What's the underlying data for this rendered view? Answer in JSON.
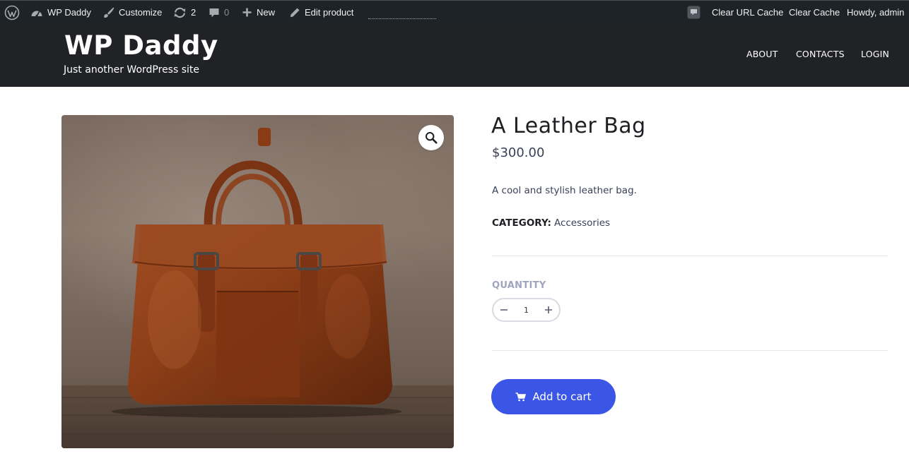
{
  "admin_bar": {
    "site_name": "WP Daddy",
    "customize": "Customize",
    "updates_count": "2",
    "comments_count": "0",
    "new": "New",
    "edit_product": "Edit product",
    "clear_url_cache": "Clear URL Cache",
    "clear_cache": "Clear Cache",
    "greeting": "Howdy, admin"
  },
  "header": {
    "title": "WP Daddy",
    "tagline": "Just another WordPress site",
    "nav": [
      "ABOUT",
      "CONTACTS",
      "LOGIN"
    ]
  },
  "product": {
    "title": "A Leather Bag",
    "price": "$300.00",
    "description": "A cool and stylish leather bag.",
    "category_label": "CATEGORY:",
    "category": "Accessories",
    "quantity_label": "QUANTITY",
    "quantity": "1",
    "add_to_cart": "Add to cart"
  },
  "colors": {
    "admin_bar": "#1d2327",
    "header": "#202226",
    "accent": "#3b55e6"
  },
  "icons": [
    "wordpress-icon",
    "dashboard-icon",
    "brush-icon",
    "updates-icon",
    "comment-icon",
    "plus-icon",
    "pencil-icon",
    "cache-icon",
    "zoom-icon",
    "minus-icon",
    "cart-icon"
  ]
}
